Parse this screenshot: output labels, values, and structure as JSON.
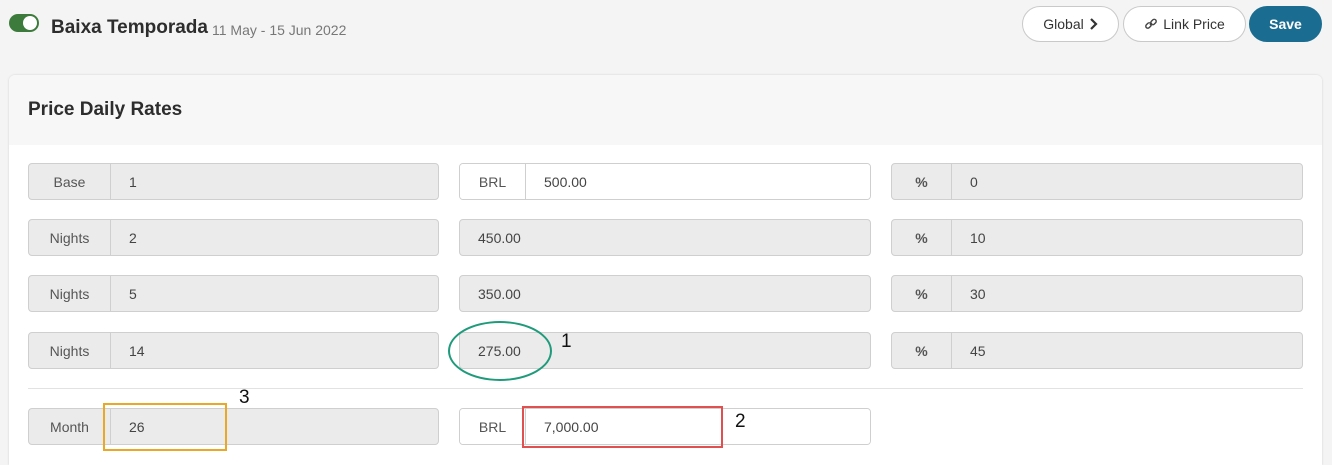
{
  "header": {
    "season_name": "Baixa Temporada",
    "season_dates": "11 May - 15 Jun 2022",
    "global_label": "Global",
    "link_price_label": "Link Price",
    "save_label": "Save",
    "toggle_on": true
  },
  "panel": {
    "title": "Price Daily Rates"
  },
  "rows": [
    {
      "label": "Base",
      "nights": "1",
      "currency": "BRL",
      "price": "500.00",
      "pct_symbol": "%",
      "pct": "0"
    },
    {
      "label": "Nights",
      "nights": "2",
      "price": "450.00",
      "pct_symbol": "%",
      "pct": "10"
    },
    {
      "label": "Nights",
      "nights": "5",
      "price": "350.00",
      "pct_symbol": "%",
      "pct": "30"
    },
    {
      "label": "Nights",
      "nights": "14",
      "price": "275.00",
      "pct_symbol": "%",
      "pct": "45"
    }
  ],
  "month_row": {
    "label": "Month",
    "value": "26",
    "currency": "BRL",
    "price": "7,000.00"
  },
  "annotations": {
    "one": "1",
    "two": "2",
    "three": "3"
  },
  "colors": {
    "toggle": "#3d7b3d",
    "save_button": "#1a6d91",
    "annotation_green": "#1f9b7b",
    "annotation_red": "#e05050",
    "annotation_orange": "#e9a825"
  }
}
